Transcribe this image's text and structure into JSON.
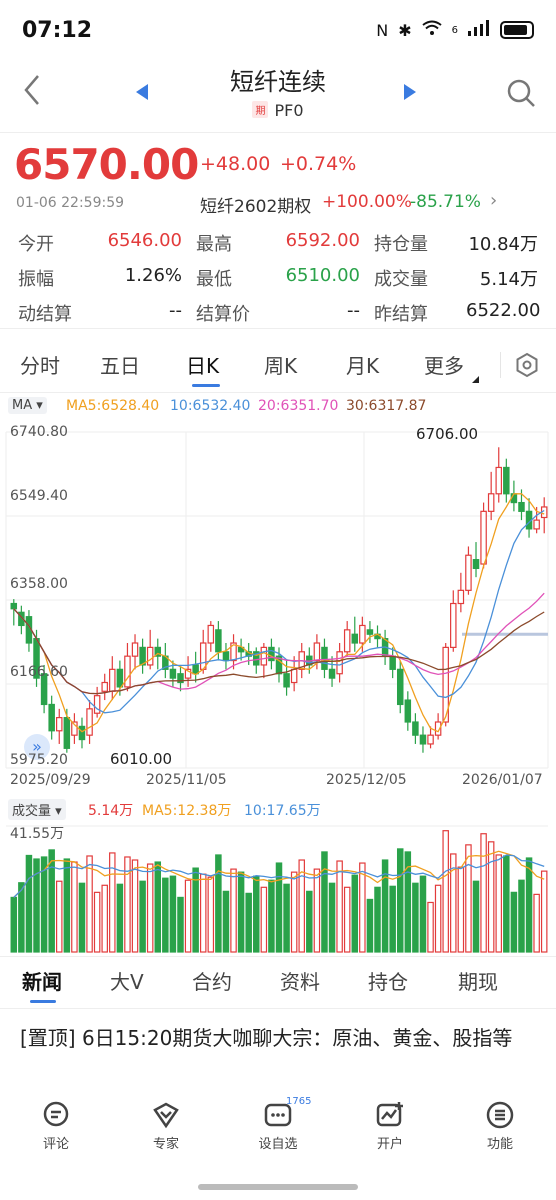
{
  "status": {
    "time": "07:12",
    "net": "6"
  },
  "nav": {
    "title": "短纤连续",
    "tag": "期",
    "code": "PF0"
  },
  "quote": {
    "price": "6570.00",
    "change": "+48.00",
    "change_pct": "+0.74%",
    "timestamp": "01-06 22:59:59",
    "option_name": "短纤2602期权",
    "option_up": "+100.00%",
    "option_down": "-85.71%",
    "rows": [
      [
        {
          "label": "今开",
          "value": "6546.00",
          "color": "#e23b3b"
        },
        {
          "label": "最高",
          "value": "6592.00",
          "color": "#e23b3b"
        },
        {
          "label": "持仓量",
          "value": "10.84万",
          "color": "#222"
        }
      ],
      [
        {
          "label": "振幅",
          "value": "1.26%",
          "color": "#222"
        },
        {
          "label": "最低",
          "value": "6510.00",
          "color": "#2aa24a"
        },
        {
          "label": "成交量",
          "value": "5.14万",
          "color": "#222"
        }
      ],
      [
        {
          "label": "动结算",
          "value": "--",
          "color": "#222"
        },
        {
          "label": "结算价",
          "value": "--",
          "color": "#222"
        },
        {
          "label": "昨结算",
          "value": "6522.00",
          "color": "#222"
        }
      ]
    ]
  },
  "tabs": [
    "分时",
    "五日",
    "日K",
    "周K",
    "月K",
    "更多"
  ],
  "ma": {
    "badge": "MA ▾",
    "ma5": "MA5:6528.40",
    "ma10": "10:6532.40",
    "ma20": "20:6351.70",
    "ma30": "30:6317.87"
  },
  "colors": {
    "up": "#e23b3b",
    "down": "#2aa24a",
    "ma5": "#f0a020",
    "ma10": "#4a90d9",
    "ma20": "#e052b8",
    "ma30": "#8b4a2b"
  },
  "chart_data": {
    "type": "candlestick",
    "y_ticks": [
      "6740.80",
      "6549.40",
      "6358.00",
      "6166.60",
      "5975.20"
    ],
    "ylim": [
      5975.2,
      6740.8
    ],
    "x_ticks": [
      "2025/09/29",
      "2025/11/05",
      "2025/12/05",
      "2026/01/07"
    ],
    "annotations": {
      "high": "6706.00",
      "low": "6010.00"
    },
    "candles": [
      [
        6350,
        6338,
        6360,
        6300
      ],
      [
        6330,
        6300,
        6345,
        6280
      ],
      [
        6320,
        6260,
        6335,
        6240
      ],
      [
        6270,
        6180,
        6290,
        6160
      ],
      [
        6190,
        6120,
        6210,
        6100
      ],
      [
        6120,
        6060,
        6140,
        6040
      ],
      [
        6060,
        6090,
        6110,
        6030
      ],
      [
        6090,
        6020,
        6110,
        6010
      ],
      [
        6050,
        6080,
        6100,
        6030
      ],
      [
        6070,
        6040,
        6090,
        6020
      ],
      [
        6050,
        6110,
        6130,
        6030
      ],
      [
        6100,
        6140,
        6160,
        6090
      ],
      [
        6150,
        6170,
        6190,
        6130
      ],
      [
        6150,
        6200,
        6230,
        6130
      ],
      [
        6200,
        6160,
        6220,
        6140
      ],
      [
        6160,
        6230,
        6260,
        6150
      ],
      [
        6230,
        6260,
        6280,
        6200
      ],
      [
        6250,
        6210,
        6270,
        6190
      ],
      [
        6210,
        6250,
        6290,
        6200
      ],
      [
        6250,
        6230,
        6270,
        6200
      ],
      [
        6230,
        6200,
        6260,
        6180
      ],
      [
        6200,
        6180,
        6220,
        6160
      ],
      [
        6190,
        6170,
        6210,
        6150
      ],
      [
        6180,
        6200,
        6230,
        6160
      ],
      [
        6210,
        6190,
        6240,
        6170
      ],
      [
        6200,
        6260,
        6290,
        6190
      ],
      [
        6260,
        6300,
        6310,
        6240
      ],
      [
        6290,
        6240,
        6310,
        6220
      ],
      [
        6240,
        6220,
        6260,
        6200
      ],
      [
        6220,
        6260,
        6280,
        6200
      ],
      [
        6250,
        6240,
        6270,
        6220
      ],
      [
        6240,
        6230,
        6260,
        6210
      ],
      [
        6240,
        6210,
        6250,
        6190
      ],
      [
        6210,
        6250,
        6260,
        6180
      ],
      [
        6250,
        6220,
        6270,
        6200
      ],
      [
        6230,
        6190,
        6250,
        6170
      ],
      [
        6190,
        6160,
        6220,
        6140
      ],
      [
        6170,
        6200,
        6230,
        6150
      ],
      [
        6200,
        6240,
        6260,
        6180
      ],
      [
        6230,
        6210,
        6250,
        6190
      ],
      [
        6220,
        6260,
        6280,
        6200
      ],
      [
        6250,
        6200,
        6270,
        6180
      ],
      [
        6200,
        6180,
        6230,
        6160
      ],
      [
        6190,
        6240,
        6260,
        6170
      ],
      [
        6240,
        6290,
        6310,
        6230
      ],
      [
        6280,
        6260,
        6320,
        6240
      ],
      [
        6260,
        6300,
        6320,
        6240
      ],
      [
        6290,
        6280,
        6310,
        6260
      ],
      [
        6280,
        6270,
        6300,
        6250
      ],
      [
        6270,
        6230,
        6290,
        6210
      ],
      [
        6230,
        6200,
        6250,
        6180
      ],
      [
        6200,
        6120,
        6220,
        6100
      ],
      [
        6130,
        6080,
        6150,
        6060
      ],
      [
        6080,
        6050,
        6100,
        6030
      ],
      [
        6050,
        6030,
        6070,
        6010
      ],
      [
        6030,
        6050,
        6070,
        6020
      ],
      [
        6050,
        6080,
        6100,
        6040
      ],
      [
        6080,
        6250,
        6260,
        6070
      ],
      [
        6250,
        6350,
        6380,
        6240
      ],
      [
        6350,
        6380,
        6420,
        6330
      ],
      [
        6380,
        6460,
        6480,
        6370
      ],
      [
        6450,
        6430,
        6490,
        6410
      ],
      [
        6440,
        6560,
        6580,
        6430
      ],
      [
        6560,
        6600,
        6650,
        6540
      ],
      [
        6600,
        6660,
        6706,
        6580
      ],
      [
        6660,
        6600,
        6680,
        6580
      ],
      [
        6600,
        6580,
        6630,
        6560
      ],
      [
        6580,
        6560,
        6610,
        6540
      ],
      [
        6560,
        6520,
        6590,
        6500
      ],
      [
        6520,
        6540,
        6570,
        6510
      ],
      [
        6546,
        6570,
        6592,
        6510
      ]
    ],
    "volume": {
      "label": "成交量 ▾",
      "current": "5.14万",
      "ma5": "MA5:12.38万",
      "ma10": "10:17.65万",
      "max_label": "41.55万"
    }
  },
  "news_tabs": [
    "新闻",
    "大V",
    "合约",
    "资料",
    "持仓",
    "期现"
  ],
  "news_item": "[置顶] 6日15:20期货大咖聊大宗：原油、黄金、股指等",
  "bottom_nav": {
    "badge": "1765",
    "items": [
      "评论",
      "专家",
      "设自选",
      "开户",
      "功能"
    ]
  }
}
